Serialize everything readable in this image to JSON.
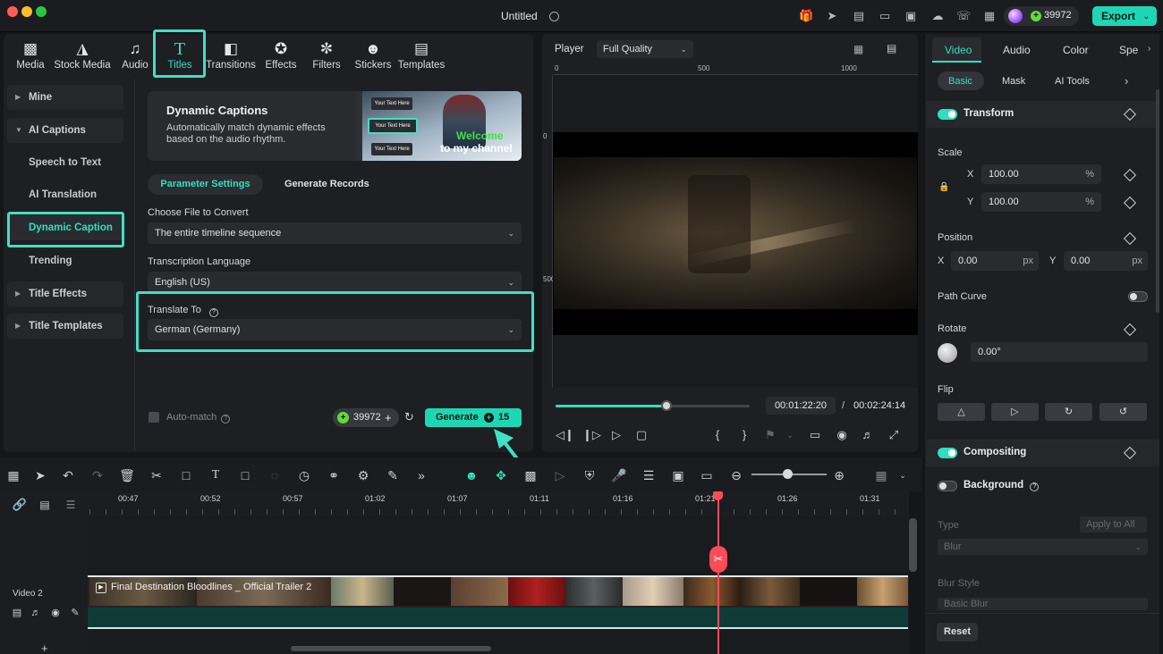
{
  "window": {
    "title": "Untitled",
    "credits": "39972",
    "export_label": "Export"
  },
  "colors": {
    "accent": "#1fd6b4",
    "highlight": "#3fe0c5",
    "playhead": "#ff4a57"
  },
  "media_tabs": [
    {
      "label": "Media",
      "icon": "media-icon"
    },
    {
      "label": "Stock Media",
      "icon": "stock-media-icon"
    },
    {
      "label": "Audio",
      "icon": "music-note-icon"
    },
    {
      "label": "Titles",
      "icon": "title-t-icon"
    },
    {
      "label": "Transitions",
      "icon": "transitions-icon"
    },
    {
      "label": "Effects",
      "icon": "effects-icon"
    },
    {
      "label": "Filters",
      "icon": "filters-icon"
    },
    {
      "label": "Stickers",
      "icon": "stickers-icon"
    },
    {
      "label": "Templates",
      "icon": "templates-icon"
    }
  ],
  "sidebar": {
    "items": [
      {
        "label": "Mine"
      },
      {
        "label": "AI Captions"
      },
      {
        "label": "Speech to Text"
      },
      {
        "label": "AI Translation"
      },
      {
        "label": "Dynamic Caption"
      },
      {
        "label": "Trending"
      },
      {
        "label": "Title Effects"
      },
      {
        "label": "Title Templates"
      }
    ]
  },
  "banner": {
    "title": "Dynamic Captions",
    "description": "Automatically match dynamic effects based on the audio rhythm.",
    "chips": [
      "Your Text Here",
      "Your Text Here",
      "Your Text Here"
    ],
    "welcome": "Welcome",
    "channel": "to my channel"
  },
  "caption_tabs": {
    "param": "Parameter Settings",
    "records": "Generate Records"
  },
  "form": {
    "file_label": "Choose File to Convert",
    "file_value": "The entire timeline sequence",
    "lang_label": "Transcription Language",
    "lang_value": "English (US)",
    "translate_label": "Translate To",
    "translate_value": "German (Germany)",
    "automatch_label": "Auto-match",
    "credit_value": "39972",
    "generate_label": "Generate",
    "generate_cost": "15"
  },
  "player": {
    "label": "Player",
    "quality": "Full Quality",
    "ruler_top": [
      "0",
      "500",
      "1000"
    ],
    "ruler_left": [
      "0",
      "500"
    ],
    "current_time": "00:01:22:20",
    "separator": "/",
    "total_time": "00:02:24:14",
    "progress": 0.57
  },
  "inspector": {
    "tabs": [
      "Video",
      "Audio",
      "Color",
      "Spe"
    ],
    "subtabs": [
      "Basic",
      "Mask",
      "AI Tools"
    ],
    "transform": "Transform",
    "scale": "Scale",
    "scale_x_label": "X",
    "scale_x": "100.00",
    "scale_y_label": "Y",
    "scale_y": "100.00",
    "percent": "%",
    "position": "Position",
    "pos_x_label": "X",
    "pos_x": "0.00",
    "pos_y_label": "Y",
    "pos_y": "0.00",
    "px": "px",
    "path_curve": "Path Curve",
    "rotate": "Rotate",
    "rotate_value": "0.00°",
    "flip": "Flip",
    "compositing": "Compositing",
    "background": "Background",
    "type_label": "Type",
    "apply_all": "Apply to All",
    "type_value": "Blur",
    "blur_style_label": "Blur Style",
    "blur_style_value": "Basic Blur",
    "reset": "Reset"
  },
  "timeline": {
    "ticks": [
      "00:47",
      "00:52",
      "00:57",
      "01:02",
      "01:07",
      "01:11",
      "01:16",
      "01:21",
      "01:26",
      "01:31"
    ],
    "clip_name": "Final Destination Bloodlines _ Official Trailer 2",
    "track_name": "Video 2"
  }
}
